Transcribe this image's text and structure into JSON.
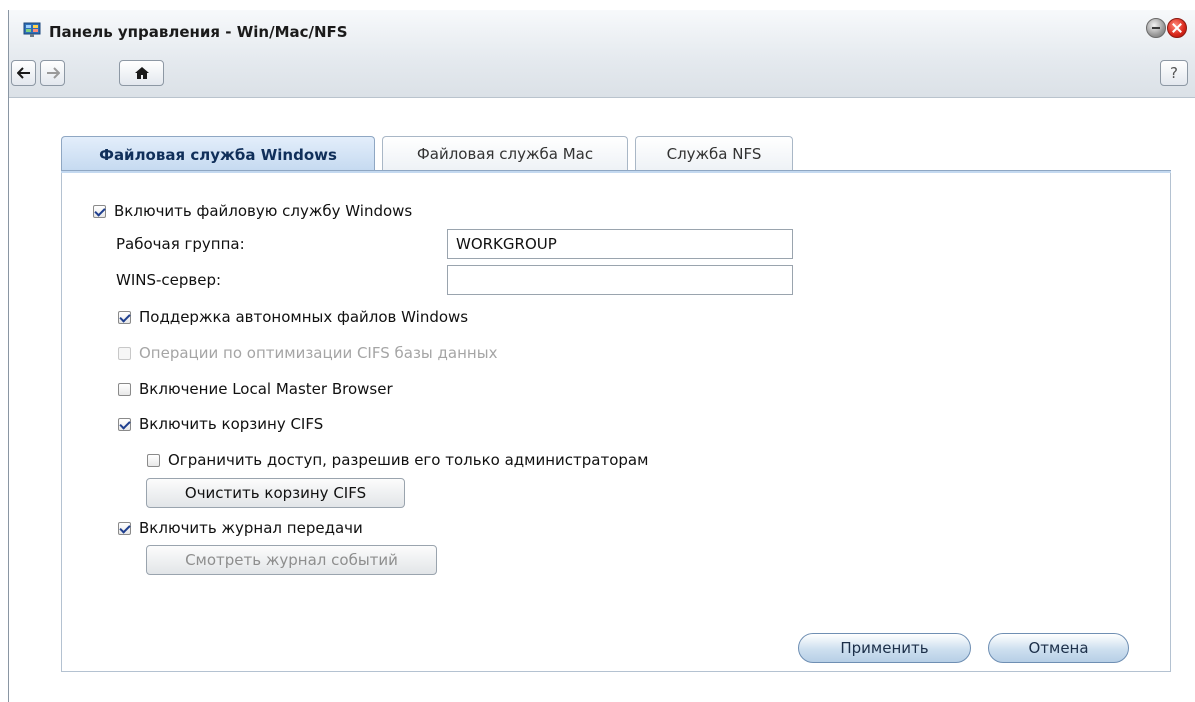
{
  "window": {
    "title": "Панель управления - Win/Mac/NFS",
    "help_label": "?"
  },
  "icons": [
    "control-panel-icon",
    "back-arrow-icon",
    "forward-arrow-icon",
    "home-icon",
    "minimize-icon",
    "close-icon"
  ],
  "tabs": [
    {
      "label": "Файловая служба Windows",
      "active": true
    },
    {
      "label": "Файловая служба Mac",
      "active": false
    },
    {
      "label": "Служба NFS",
      "active": false
    }
  ],
  "windows_service": {
    "enable_label": "Включить файловую службу Windows",
    "enable_checked": true,
    "workgroup_label": "Рабочая группа:",
    "workgroup_value": "WORKGROUP",
    "wins_label": "WINS-сервер:",
    "wins_value": "",
    "offline_files_label": "Поддержка автономных файлов Windows",
    "offline_files_checked": true,
    "cifs_db_label": "Операции по оптимизации CIFS базы данных",
    "cifs_db_checked": false,
    "cifs_db_disabled": true,
    "local_master_label": "Включение Local Master Browser",
    "local_master_checked": false,
    "recycle_bin_label": "Включить корзину CIFS",
    "recycle_bin_checked": true,
    "restrict_admin_label": "Ограничить доступ, разрешив его только администраторам",
    "restrict_admin_checked": false,
    "clear_recycle_label": "Очистить корзину CIFS",
    "transfer_log_label": "Включить журнал передачи",
    "transfer_log_checked": true,
    "view_log_label": "Смотреть журнал событий"
  },
  "footer": {
    "apply_label": "Применить",
    "cancel_label": "Отмена"
  }
}
